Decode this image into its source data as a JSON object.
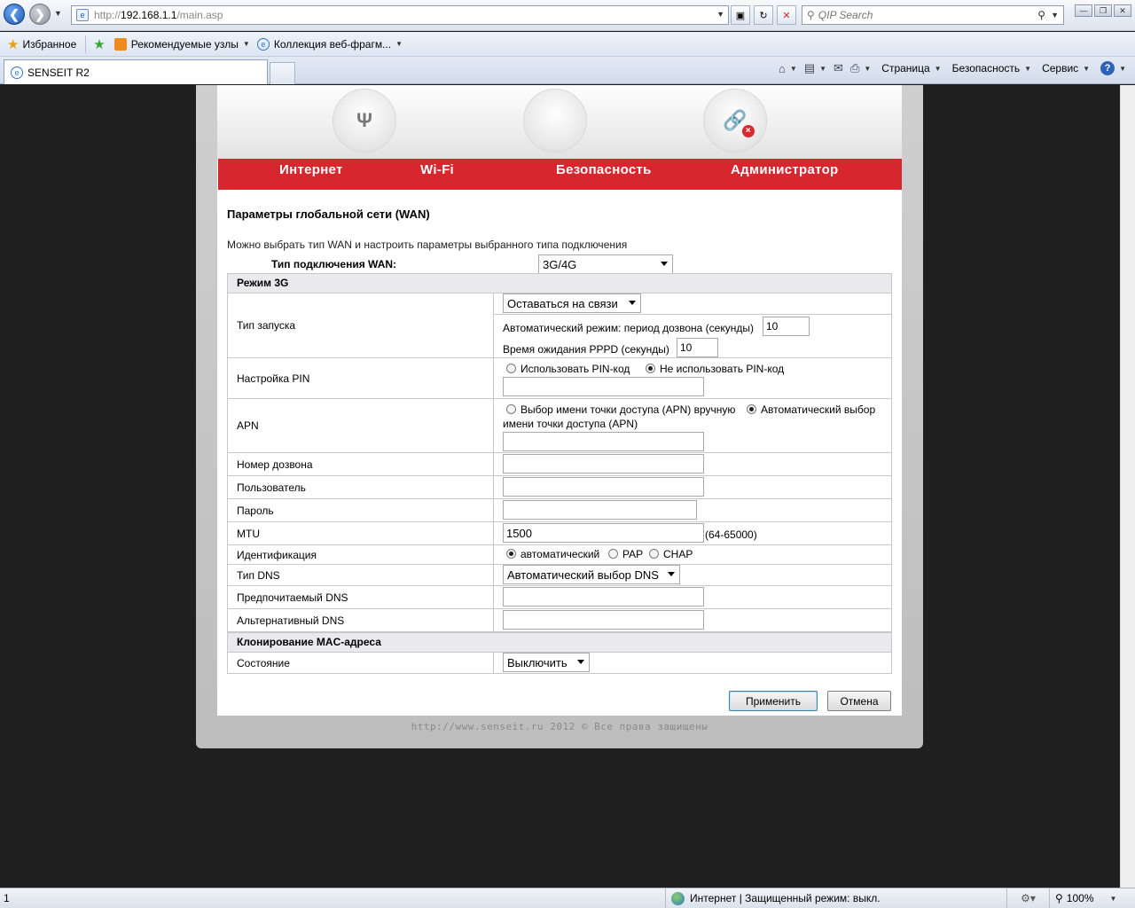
{
  "browser": {
    "url_prefix": "http://",
    "url_host": "192.168.1.1",
    "url_path": "/main.asp",
    "search_placeholder": "QIP Search",
    "favorites": {
      "label": "Избранное",
      "suggested": "Рекомендуемые узлы",
      "gallery": "Коллекция веб-фрагм..."
    },
    "tab_title": "SENSEIT R2",
    "commands": {
      "page": "Страница",
      "security": "Безопасность",
      "service": "Сервис"
    }
  },
  "router": {
    "menu": [
      "Интернет",
      "Wi-Fi",
      "Безопасность",
      "Администратор"
    ],
    "title": "Параметры глобальной сети (WAN)",
    "description": "Можно выбрать тип WAN и настроить параметры выбранного типа подключения",
    "wan_type_label": "Тип подключения WAN:",
    "wan_type_value": "3G/4G",
    "section_3g": "Режим 3G",
    "start_type": {
      "label": "Тип запуска",
      "value": "Оставаться на связи",
      "auto_label": "Автоматический режим: период дозвона (секунды)",
      "auto_value": "10",
      "pppd_label": "Время ожидания PPPD (секунды)",
      "pppd_value": "10"
    },
    "pin": {
      "label": "Настройка PIN",
      "opt_use": "Использовать PIN-код",
      "opt_no": "Не использовать PIN-код",
      "selected": "no"
    },
    "apn": {
      "label": "APN",
      "opt_manual": "Выбор имени точки доступа (APN) вручную",
      "opt_auto_line1": "Автоматический выбор",
      "opt_auto_line2": "имени точки доступа (APN)",
      "selected": "auto"
    },
    "dial_number": {
      "label": "Номер дозвона",
      "value": ""
    },
    "user": {
      "label": "Пользователь",
      "value": ""
    },
    "password": {
      "label": "Пароль",
      "value": ""
    },
    "mtu": {
      "label": "MTU",
      "value": "1500",
      "range": "(64-65000)"
    },
    "auth": {
      "label": "Идентификация",
      "opt_auto": "автоматический",
      "opt_pap": "PAP",
      "opt_chap": "CHAP",
      "selected": "auto"
    },
    "dns_type": {
      "label": "Тип DNS",
      "value": "Автоматический выбор DNS"
    },
    "dns_primary": {
      "label": "Предпочитаемый DNS",
      "value": ""
    },
    "dns_alt": {
      "label": "Альтернативный DNS",
      "value": ""
    },
    "section_mac": "Клонирование MAC-адреса",
    "mac_state": {
      "label": "Состояние",
      "value": "Выключить"
    },
    "apply": "Применить",
    "cancel": "Отмена",
    "footer": "http://www.senseit.ru 2012 © Все права защищены"
  },
  "statusbar": {
    "left": "1",
    "zone": "Интернет | Защищенный режим: выкл.",
    "zoom": "100%"
  }
}
